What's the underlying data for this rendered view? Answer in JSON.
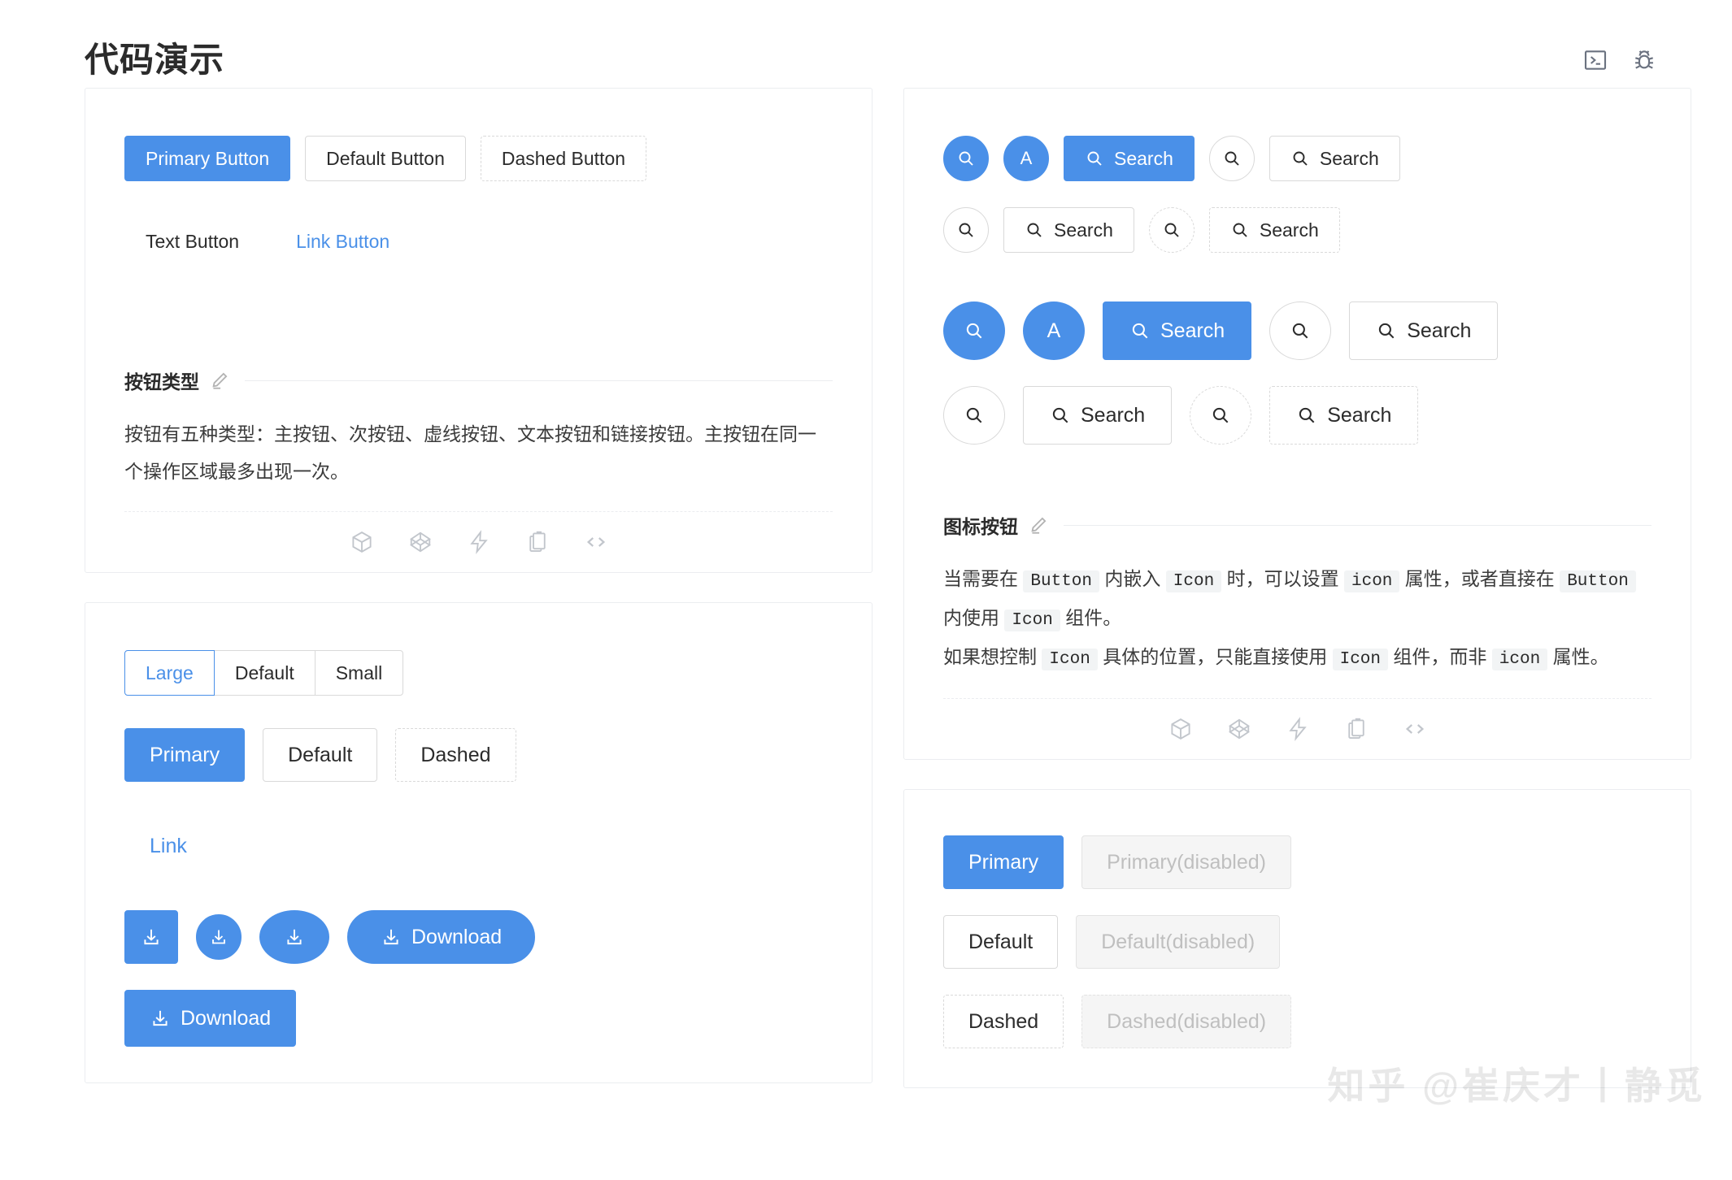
{
  "header": {
    "title": "代码演示",
    "icons": [
      {
        "name": "console-icon",
        "label": "console"
      },
      {
        "name": "bug-icon",
        "label": "bug"
      }
    ]
  },
  "watermark": "知乎 @崔庆才丨静觅",
  "colors": {
    "primary": "#4a90e8",
    "link": "#4a90e8",
    "border": "#d9d9d9",
    "card_border": "#ebedf0",
    "disabled_bg": "#f5f5f5",
    "disabled_text": "#bfbfbf"
  },
  "action_icons": [
    {
      "name": "codesandbox-icon",
      "label": "CodeSandbox"
    },
    {
      "name": "codepen-icon",
      "label": "CodePen"
    },
    {
      "name": "stackblitz-icon",
      "label": "StackBlitz"
    },
    {
      "name": "copy-icon",
      "label": "复制代码"
    },
    {
      "name": "code-icon",
      "label": "显示代码"
    }
  ],
  "cards": {
    "button_types": {
      "buttons_row1": [
        {
          "label": "Primary Button",
          "type": "primary"
        },
        {
          "label": "Default Button",
          "type": "default"
        },
        {
          "label": "Dashed Button",
          "type": "dashed"
        }
      ],
      "buttons_row2": [
        {
          "label": "Text Button",
          "type": "text"
        },
        {
          "label": "Link Button",
          "type": "link"
        }
      ],
      "meta_title": "按钮类型",
      "meta_desc": "按钮有五种类型：主按钮、次按钮、虚线按钮、文本按钮和链接按钮。主按钮在同一个操作区域最多出现一次。"
    },
    "button_size": {
      "size_group": [
        {
          "label": "Large",
          "active": true
        },
        {
          "label": "Default",
          "active": false
        },
        {
          "label": "Small",
          "active": false
        }
      ],
      "type_row": [
        {
          "label": "Primary",
          "type": "primary"
        },
        {
          "label": "Default",
          "type": "default"
        },
        {
          "label": "Dashed",
          "type": "dashed"
        }
      ],
      "link_label": "Link",
      "download_label": "Download"
    },
    "icon_button": {
      "meta_title": "图标按钮",
      "desc_line1_parts": [
        {
          "t": "text",
          "v": "当需要在 "
        },
        {
          "t": "code",
          "v": "Button"
        },
        {
          "t": "text",
          "v": " 内嵌入 "
        },
        {
          "t": "code",
          "v": "Icon"
        },
        {
          "t": "text",
          "v": " 时，可以设置 "
        },
        {
          "t": "code",
          "v": "icon"
        },
        {
          "t": "text",
          "v": " 属性，或者直接在 "
        },
        {
          "t": "code",
          "v": "Button"
        },
        {
          "t": "text",
          "v": " 内使用 "
        },
        {
          "t": "code",
          "v": "Icon"
        },
        {
          "t": "text",
          "v": " 组件。"
        }
      ],
      "desc_line2_parts": [
        {
          "t": "text",
          "v": "如果想控制 "
        },
        {
          "t": "code",
          "v": "Icon"
        },
        {
          "t": "text",
          "v": " 具体的位置，只能直接使用 "
        },
        {
          "t": "code",
          "v": "Icon"
        },
        {
          "t": "text",
          "v": " 组件，而非 "
        },
        {
          "t": "code",
          "v": "icon"
        },
        {
          "t": "text",
          "v": " 属性。"
        }
      ],
      "search_label": "Search",
      "avatar_label": "A"
    },
    "disabled": {
      "rows": [
        {
          "enabled": "Primary",
          "disabled": "Primary(disabled)",
          "type": "primary"
        },
        {
          "enabled": "Default",
          "disabled": "Default(disabled)",
          "type": "default"
        },
        {
          "enabled": "Dashed",
          "disabled": "Dashed(disabled)",
          "type": "dashed"
        }
      ]
    }
  }
}
